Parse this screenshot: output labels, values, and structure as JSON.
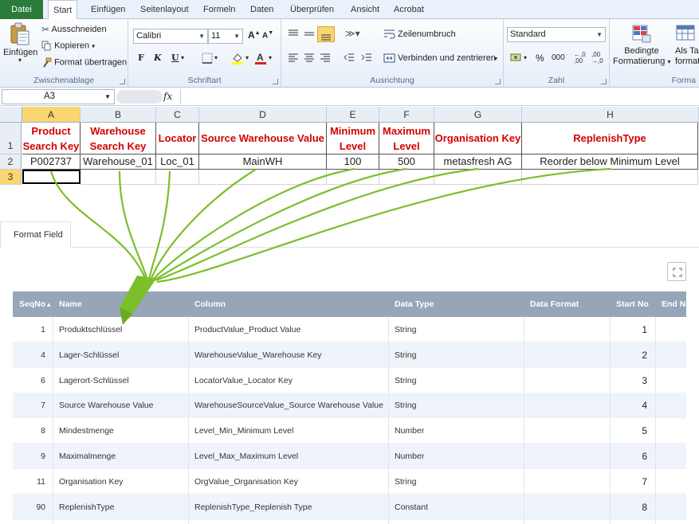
{
  "ribbon_tabs": [
    "Datei",
    "Start",
    "Einfügen",
    "Seitenlayout",
    "Formeln",
    "Daten",
    "Überprüfen",
    "Ansicht",
    "Acrobat"
  ],
  "clipboard": {
    "paste": "Einfügen",
    "cut": "Ausschneiden",
    "copy": "Kopieren",
    "format_painter": "Format übertragen",
    "label": "Zwischenablage"
  },
  "font": {
    "name": "Calibri",
    "size": "11",
    "label": "Schriftart",
    "bold": "F",
    "italic": "K",
    "underline": "U"
  },
  "alignment": {
    "wrap": "Zeilenumbruch",
    "merge": "Verbinden und zentrieren",
    "label": "Ausrichtung"
  },
  "number": {
    "format": "Standard",
    "percent": "%",
    "thousands": "000",
    "label": "Zahl"
  },
  "styles": {
    "conditional_line1": "Bedingte",
    "conditional_line2": "Formatierung",
    "table_line1": "Als Ta",
    "table_line2": "formati",
    "label": "Forma"
  },
  "formula_bar": {
    "name_box": "A3",
    "fx": "fx"
  },
  "sheet": {
    "columns": [
      "A",
      "B",
      "C",
      "D",
      "E",
      "F",
      "G",
      "H"
    ],
    "rows": [
      "1",
      "2",
      "3"
    ],
    "headers": [
      [
        "Product",
        "Search Key"
      ],
      [
        "Warehouse",
        "Search Key"
      ],
      [
        "Locator"
      ],
      [
        "Source Warehouse Value"
      ],
      [
        "Minimum",
        "Level"
      ],
      [
        "Maximum",
        "Level"
      ],
      [
        "Organisation Key"
      ],
      [
        "ReplenishType"
      ]
    ],
    "values": [
      "P002737",
      "Warehouse_01",
      "Loc_01",
      "MainWH",
      "100",
      "500",
      "metasfresh AG",
      "Reorder below Minimum Level"
    ]
  },
  "panel": {
    "tab": "Format Field",
    "columns": [
      "SeqNo",
      "Name",
      "Column",
      "Data Type",
      "Data Format",
      "Start No",
      "End No"
    ],
    "sort_indicator": "▲",
    "rows": [
      {
        "seq": "1",
        "name": "Produktschlüssel",
        "column": "ProductValue_Product Value",
        "type": "String",
        "start": "1"
      },
      {
        "seq": "4",
        "name": "Lager-Schlüssel",
        "column": "WarehouseValue_Warehouse Key",
        "type": "String",
        "start": "2"
      },
      {
        "seq": "6",
        "name": "Lagerort-Schlüssel",
        "column": "LocatorValue_Locator Key",
        "type": "String",
        "start": "3"
      },
      {
        "seq": "7",
        "name": "Source Warehouse Value",
        "column": "WarehouseSourceValue_Source Warehouse Value",
        "type": "String",
        "start": "4"
      },
      {
        "seq": "8",
        "name": "Mindestmenge",
        "column": "Level_Min_Minimum Level",
        "type": "Number",
        "start": "5"
      },
      {
        "seq": "9",
        "name": "Maximalmenge",
        "column": "Level_Max_Maximum Level",
        "type": "Number",
        "start": "6"
      },
      {
        "seq": "11",
        "name": "Organisation Key",
        "column": "OrgValue_Organisation Key",
        "type": "String",
        "start": "7"
      },
      {
        "seq": "90",
        "name": "ReplenishType",
        "column": "ReplenishType_Replenish Type",
        "type": "Constant",
        "start": "8"
      }
    ]
  },
  "colors": {
    "excel_green": "#2a7a3a",
    "header_red": "#d40000",
    "arrow_green": "#7bbf2a",
    "table_header": "#96a6b8"
  }
}
